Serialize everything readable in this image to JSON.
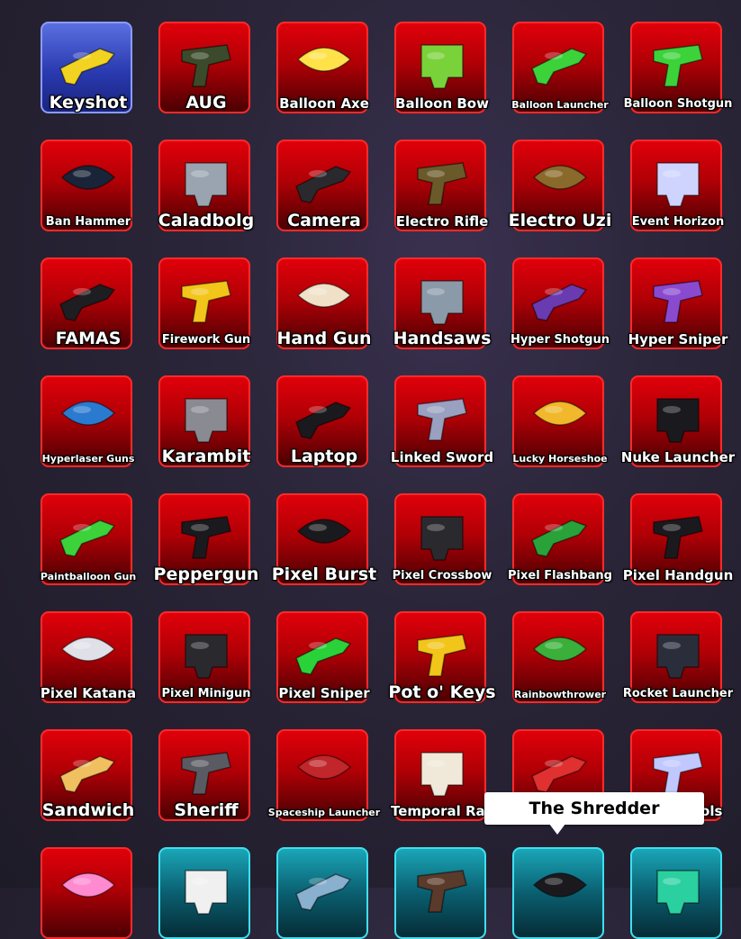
{
  "inventory": {
    "items": [
      {
        "label": "Keyshot",
        "size": "big",
        "style": "blue",
        "icon": "key-gun-icon",
        "color": "#f2d321"
      },
      {
        "label": "AUG",
        "size": "big",
        "style": "red",
        "icon": "rifle-icon",
        "color": "#3a4a2a"
      },
      {
        "label": "Balloon Axe",
        "size": "mid",
        "style": "red",
        "icon": "balloon-axe-icon",
        "color": "#ffe24a"
      },
      {
        "label": "Balloon Bow",
        "size": "mid",
        "style": "red",
        "icon": "bow-icon",
        "color": "#7ad23a"
      },
      {
        "label": "Balloon Launcher",
        "size": "xs",
        "style": "red",
        "icon": "balloon-launcher-icon",
        "color": "#3cd23a"
      },
      {
        "label": "Balloon Shotgun",
        "size": "sm",
        "style": "red",
        "icon": "balloon-shotgun-icon",
        "color": "#3cd23a"
      },
      {
        "label": "Ban Hammer",
        "size": "sm",
        "style": "red",
        "icon": "hammer-icon",
        "color": "#1a2438"
      },
      {
        "label": "Caladbolg",
        "size": "big",
        "style": "red",
        "icon": "sword-icon",
        "color": "#9aa4b0"
      },
      {
        "label": "Camera",
        "size": "big",
        "style": "red",
        "icon": "camera-icon",
        "color": "#2a2a2e"
      },
      {
        "label": "Electro Rifle",
        "size": "mid",
        "style": "red",
        "icon": "electro-rifle-icon",
        "color": "#6a5a2a"
      },
      {
        "label": "Electro Uzi",
        "size": "big",
        "style": "red",
        "icon": "uzi-icon",
        "color": "#8a6a2a"
      },
      {
        "label": "Event Horizon",
        "size": "sm",
        "style": "red",
        "icon": "spiral-gun-icon",
        "color": "#cfd4ff"
      },
      {
        "label": "FAMAS",
        "size": "big",
        "style": "red",
        "icon": "rifle-icon",
        "color": "#1e1e22"
      },
      {
        "label": "Firework Gun",
        "size": "sm",
        "style": "red",
        "icon": "firework-gun-icon",
        "color": "#f2c51a"
      },
      {
        "label": "Hand Gun",
        "size": "big",
        "style": "red",
        "icon": "hand-icon",
        "color": "#f0e0c8"
      },
      {
        "label": "Handsaws",
        "size": "big",
        "style": "red",
        "icon": "saw-icon",
        "color": "#8a9aa8"
      },
      {
        "label": "Hyper Shotgun",
        "size": "sm",
        "style": "red",
        "icon": "shotgun-icon",
        "color": "#6a3ab0"
      },
      {
        "label": "Hyper Sniper",
        "size": "mid",
        "style": "red",
        "icon": "sniper-icon",
        "color": "#8a4ad0"
      },
      {
        "label": "Hyperlaser Guns",
        "size": "xs",
        "style": "red",
        "icon": "laser-gun-icon",
        "color": "#2a7ad0"
      },
      {
        "label": "Karambit",
        "size": "big",
        "style": "red",
        "icon": "knife-icon",
        "color": "#8a8a92"
      },
      {
        "label": "Laptop",
        "size": "big",
        "style": "red",
        "icon": "laptop-icon",
        "color": "#1a1a1e"
      },
      {
        "label": "Linked Sword",
        "size": "mid",
        "style": "red",
        "icon": "sword-icon",
        "color": "#9aa0c0"
      },
      {
        "label": "Lucky Horseshoe",
        "size": "xs",
        "style": "red",
        "icon": "horseshoe-icon",
        "color": "#f0b82a"
      },
      {
        "label": "Nuke Launcher",
        "size": "mid",
        "style": "red",
        "icon": "launcher-icon",
        "color": "#1a1a1e"
      },
      {
        "label": "Paintballoon Gun",
        "size": "xs",
        "style": "red",
        "icon": "paintball-gun-icon",
        "color": "#3cd23a"
      },
      {
        "label": "Peppergun",
        "size": "big",
        "style": "red",
        "icon": "pepper-gun-icon",
        "color": "#1a1a1e"
      },
      {
        "label": "Pixel Burst",
        "size": "big",
        "style": "red",
        "icon": "pixel-rifle-icon",
        "color": "#1a1a1e"
      },
      {
        "label": "Pixel Crossbow",
        "size": "sm",
        "style": "red",
        "icon": "crossbow-icon",
        "color": "#2a2a2e"
      },
      {
        "label": "Pixel Flashbang",
        "size": "sm",
        "style": "red",
        "icon": "grenade-icon",
        "color": "#2aa23a"
      },
      {
        "label": "Pixel Handgun",
        "size": "mid",
        "style": "red",
        "icon": "pistol-icon",
        "color": "#1a1a1e"
      },
      {
        "label": "Pixel Katana",
        "size": "mid",
        "style": "red",
        "icon": "katana-icon",
        "color": "#e0e0e8"
      },
      {
        "label": "Pixel Minigun",
        "size": "sm",
        "style": "red",
        "icon": "minigun-icon",
        "color": "#2a2a2e"
      },
      {
        "label": "Pixel Sniper",
        "size": "mid",
        "style": "red",
        "icon": "pixel-sniper-icon",
        "color": "#2ad23a"
      },
      {
        "label": "Pot o' Keys",
        "size": "big",
        "style": "red",
        "icon": "pot-icon",
        "color": "#f2c51a"
      },
      {
        "label": "Rainbowthrower",
        "size": "xs",
        "style": "red",
        "icon": "rainbow-gun-icon",
        "color": "#3ab03a"
      },
      {
        "label": "Rocket Launcher",
        "size": "sm",
        "style": "red",
        "icon": "rocket-launcher-icon",
        "color": "#2a2e3a"
      },
      {
        "label": "Sandwich",
        "size": "big",
        "style": "red",
        "icon": "sandwich-icon",
        "color": "#f0c060"
      },
      {
        "label": "Sheriff",
        "size": "big",
        "style": "red",
        "icon": "revolver-icon",
        "color": "#5a5a62"
      },
      {
        "label": "Spaceship Launcher",
        "size": "xs",
        "style": "red",
        "icon": "spaceship-launcher-icon",
        "color": "#c0262a"
      },
      {
        "label": "Temporal Ray",
        "size": "mid",
        "style": "red",
        "icon": "ray-gun-icon",
        "color": "#f0e8d8"
      },
      {
        "label": "The Shredder",
        "size": "mid",
        "style": "red",
        "icon": "guitar-icon",
        "color": "#e03030"
      },
      {
        "label": "Void Pistols",
        "size": "mid",
        "style": "red",
        "icon": "void-pistol-icon",
        "color": "#c0c8ff"
      },
      {
        "label": "",
        "size": "sm",
        "style": "red",
        "icon": "balloon-icon",
        "color": "#ff8ad0"
      },
      {
        "label": "",
        "size": "sm",
        "style": "cyan",
        "icon": "cards-icon",
        "color": "#f0f0f0"
      },
      {
        "label": "",
        "size": "sm",
        "style": "cyan",
        "icon": "gadget-icon",
        "color": "#8ab0d0"
      },
      {
        "label": "",
        "size": "sm",
        "style": "cyan",
        "icon": "gun-icon",
        "color": "#5a3a2a"
      },
      {
        "label": "",
        "size": "sm",
        "style": "cyan",
        "icon": "gun-icon",
        "color": "#1a1a1e"
      },
      {
        "label": "",
        "size": "sm",
        "style": "cyan",
        "icon": "gun-icon",
        "color": "#2ad0a0"
      }
    ]
  },
  "tooltip": {
    "text": "The Shredder"
  }
}
